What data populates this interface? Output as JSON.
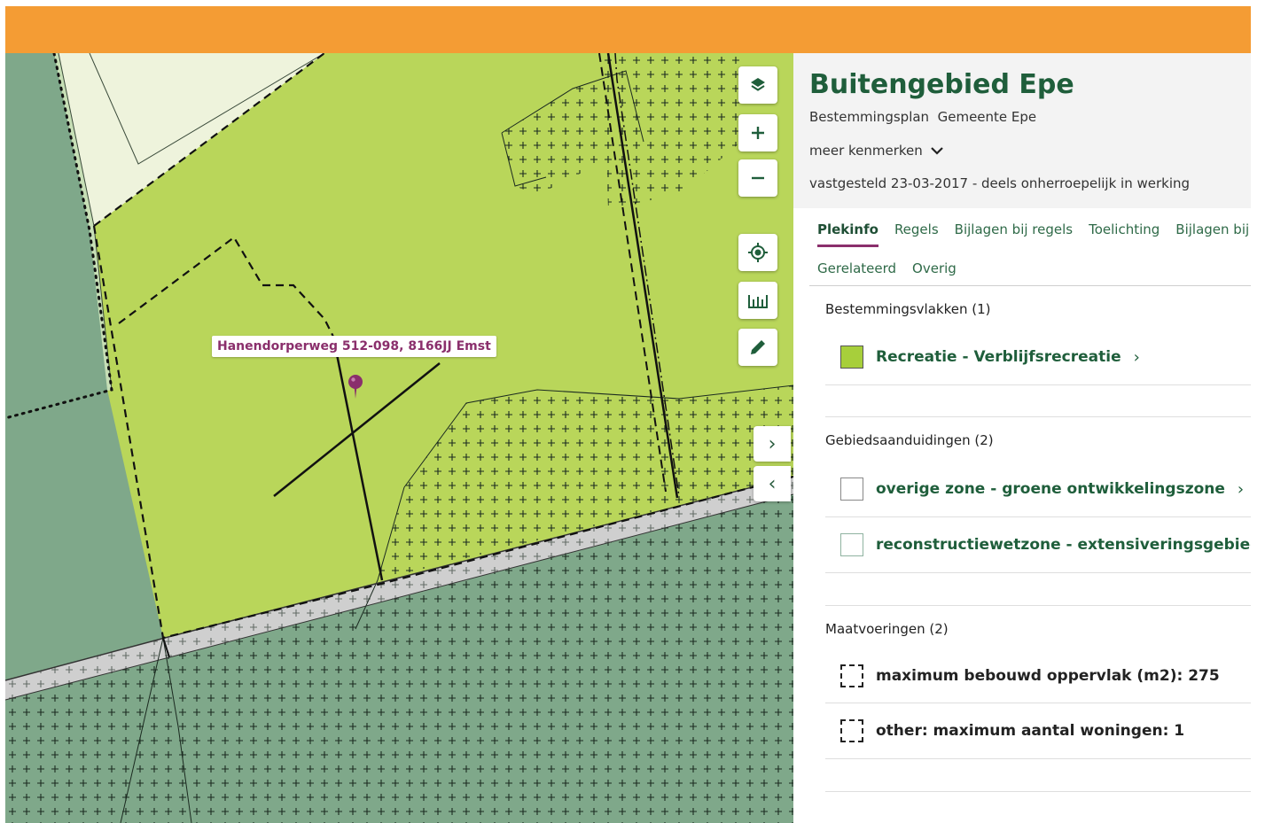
{
  "colors": {
    "topbar": "#F49C34",
    "agri_green": "#b9d65a",
    "forest_green": "#7fa88a",
    "pale_yellow": "#eef3dc",
    "light_green_strip": "#c7dfb6",
    "road_grey": "#cfcfcf",
    "brand_green": "#1f5e3b",
    "accent_purple": "#8a2f6c",
    "swatch_recreatie": "#a7cf3b",
    "swatch_overige": "#ffffff",
    "swatch_reconstructie": "#ffffff"
  },
  "map": {
    "address_label": "Hanendorperweg 512-098, 8166JJ Emst",
    "controls": [
      {
        "name": "layers-icon"
      },
      {
        "name": "zoom-in-icon"
      },
      {
        "name": "zoom-out-icon"
      },
      {
        "name": "locate-icon"
      },
      {
        "name": "measure-icon"
      },
      {
        "name": "draw-icon"
      }
    ],
    "panel_toggle": {
      "expand": "›",
      "collapse": "‹"
    }
  },
  "panel": {
    "title": "Buitengebied Epe",
    "subtitle": "Bestemmingsplan  Gemeente Epe",
    "more_label": "meer kenmerken",
    "status": "vastgesteld 23-03-2017 - deels onherroepelijk in werking",
    "tabs_row1": [
      "Plekinfo",
      "Regels",
      "Bijlagen bij regels",
      "Toelichting",
      "Bijlagen bij toelichting"
    ],
    "tabs_row2": [
      "Gerelateerd",
      "Overig"
    ],
    "active_tab": "Plekinfo",
    "sections": {
      "bestemmingsvlakken": {
        "title": "Bestemmingsvlakken (1)",
        "items": [
          {
            "label": "Recreatie - Verblijfsrecreatie",
            "chevron": "›"
          }
        ]
      },
      "gebiedsaanduidingen": {
        "title": "Gebiedsaanduidingen (2)",
        "items": [
          {
            "label": "overige zone - groene ontwikkelingszone",
            "chevron": "›"
          },
          {
            "label": "reconstructiewetzone - extensiveringsgebied",
            "chevron": "›"
          }
        ]
      },
      "maatvoeringen": {
        "title": "Maatvoeringen (2)",
        "items": [
          {
            "label": "maximum bebouwd oppervlak (m2): 275"
          },
          {
            "label": "other: maximum aantal woningen: 1"
          }
        ]
      }
    }
  }
}
